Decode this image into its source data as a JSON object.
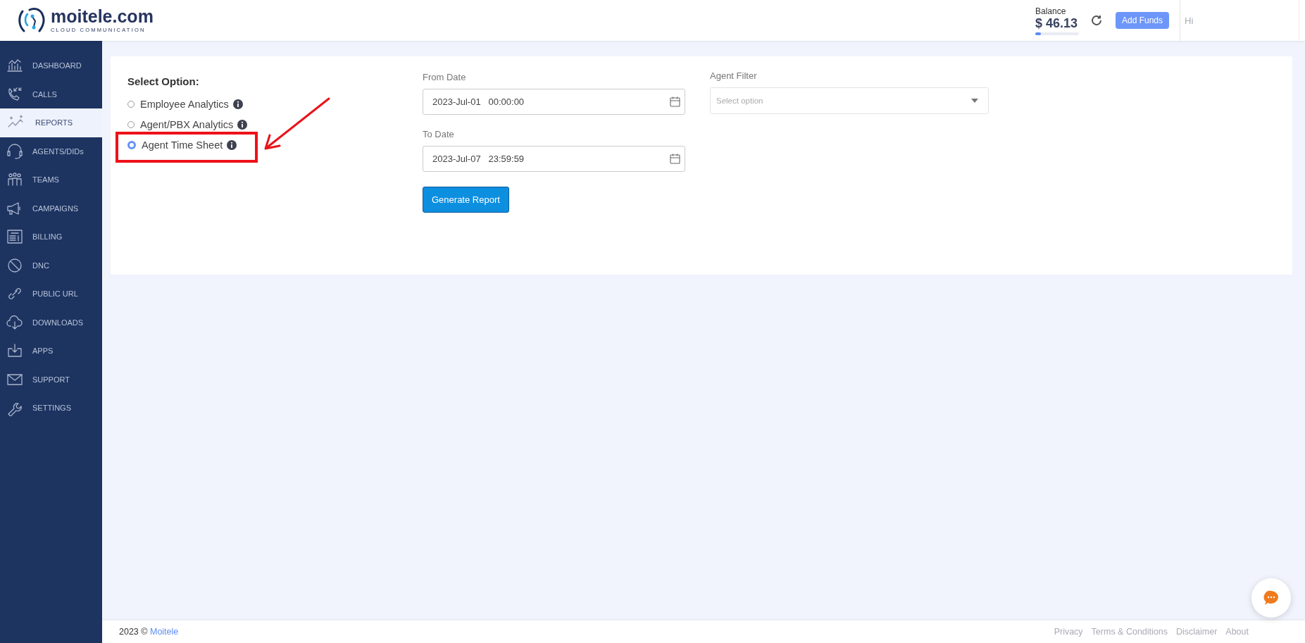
{
  "header": {
    "logo": {
      "name": "moitele.com",
      "tagline": "CLOUD COMMUNICATION"
    },
    "balance": {
      "label": "Balance",
      "amount": "$ 46.13",
      "level": 0.13
    },
    "add_funds": "Add Funds",
    "greeting": "Hi"
  },
  "sidebar": {
    "items": [
      {
        "label": "DASHBOARD",
        "selected": false
      },
      {
        "label": "CALLS",
        "selected": false
      },
      {
        "label": "REPORTS",
        "selected": true
      },
      {
        "label": "AGENTS/DIDs",
        "selected": false
      },
      {
        "label": "TEAMS",
        "selected": false
      },
      {
        "label": "CAMPAIGNS",
        "selected": false
      },
      {
        "label": "BILLING",
        "selected": false
      },
      {
        "label": "DNC",
        "selected": false
      },
      {
        "label": "PUBLIC URL",
        "selected": false
      },
      {
        "label": "DOWNLOADS",
        "selected": false
      },
      {
        "label": "APPS",
        "selected": false
      },
      {
        "label": "SUPPORT",
        "selected": false
      },
      {
        "label": "SETTINGS",
        "selected": false
      }
    ]
  },
  "form": {
    "title": "Select Option:",
    "options": [
      {
        "label": "Employee Analytics",
        "selected": false
      },
      {
        "label": "Agent/PBX Analytics",
        "selected": false
      },
      {
        "label": "Agent Time Sheet",
        "selected": true
      }
    ],
    "from_date": {
      "label": "From Date",
      "value": "2023-Jul-01   00:00:00"
    },
    "to_date": {
      "label": "To Date",
      "value": "2023-Jul-07   23:59:59"
    },
    "agent_filter": {
      "label": "Agent Filter",
      "placeholder": "Select option"
    },
    "generate_button": "Generate Report"
  },
  "footer": {
    "copyright": "2023 ©",
    "brand": "Moitele",
    "links": [
      "Privacy",
      "Terms & Conditions",
      "Disclaimer",
      "About"
    ]
  }
}
